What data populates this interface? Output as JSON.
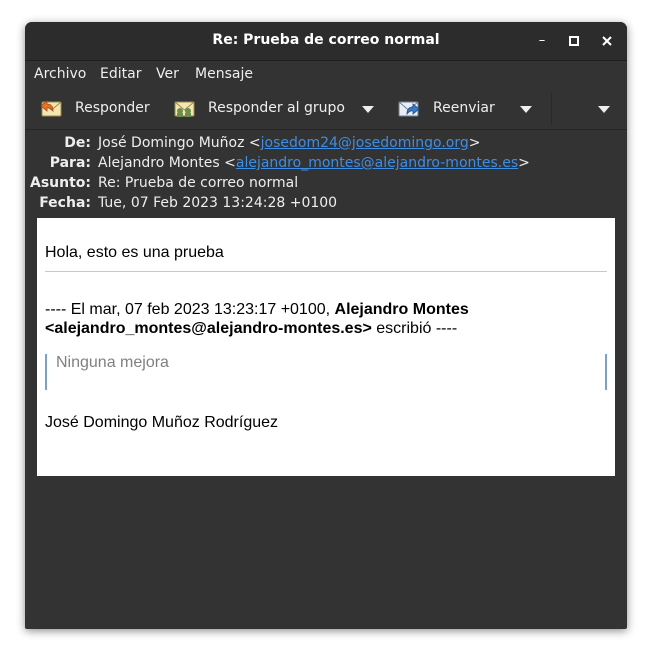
{
  "window": {
    "title": "Re: Prueba de correo normal",
    "controls": {
      "minimize": "–",
      "maximize": "□",
      "close": "✕"
    }
  },
  "menu": [
    "Archivo",
    "Editar",
    "Ver",
    "Mensaje"
  ],
  "toolbar": {
    "reply": "Responder",
    "reply_all": "Responder al grupo",
    "forward": "Reenviar",
    "icons": {
      "reply": "reply-icon",
      "reply_all": "reply-all-icon",
      "forward": "forward-icon"
    }
  },
  "headers": {
    "from": {
      "label": "De:",
      "name": "José Domingo Muñoz <",
      "email": "josedom24@josedomingo.org",
      "close": ">"
    },
    "to": {
      "label": "Para:",
      "name": "Alejandro Montes <",
      "email": "alejandro_montes@alejandro-montes.es",
      "close": ">"
    },
    "subject": {
      "label": "Asunto:",
      "value": "Re: Prueba de correo normal"
    },
    "date": {
      "label": "Fecha:",
      "value": "Tue, 07 Feb 2023 13:24:28 +0100"
    }
  },
  "body": {
    "greeting": "Hola, esto es una prueba",
    "quote_intro_prefix": "---- El mar, 07 feb 2023 13:23:17 +0100, ",
    "quote_intro_author": "Alejandro Montes <alejandro_montes@alejandro-montes.es>",
    "quote_intro_suffix": " escribió ----",
    "quoted_text": "Ninguna mejora",
    "signature": "José Domingo Muñoz Rodríguez"
  },
  "colors": {
    "window_bg": "#333333",
    "link": "#3d8ee6",
    "quote_border": "#7ca0bf"
  }
}
